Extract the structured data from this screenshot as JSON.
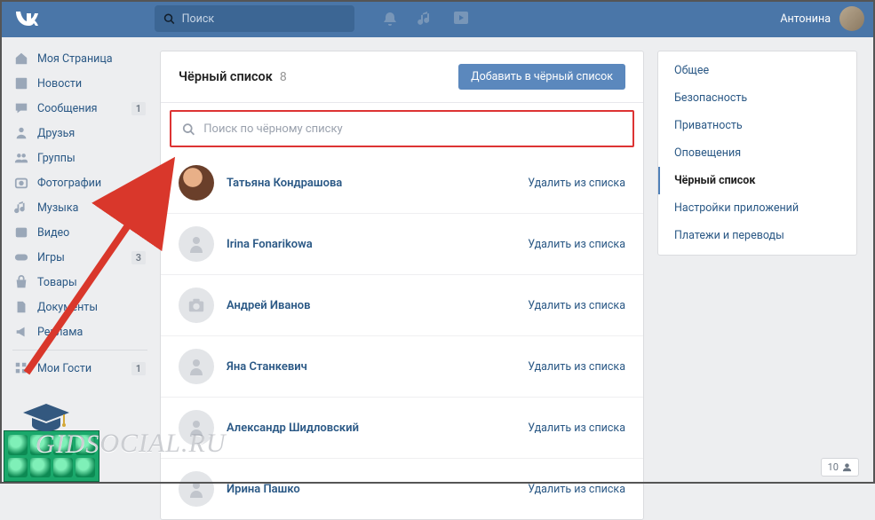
{
  "header": {
    "search_placeholder": "Поиск",
    "username": "Антонина"
  },
  "nav": {
    "items": [
      {
        "label": "Моя Страница",
        "icon": "home"
      },
      {
        "label": "Новости",
        "icon": "news"
      },
      {
        "label": "Сообщения",
        "icon": "chat",
        "badge": "1"
      },
      {
        "label": "Друзья",
        "icon": "friends"
      },
      {
        "label": "Группы",
        "icon": "groups"
      },
      {
        "label": "Фотографии",
        "icon": "photos"
      },
      {
        "label": "Музыка",
        "icon": "music"
      },
      {
        "label": "Видео",
        "icon": "video"
      },
      {
        "label": "Игры",
        "icon": "games",
        "badge": "3"
      },
      {
        "label": "Товары",
        "icon": "market"
      },
      {
        "label": "Документы",
        "icon": "docs"
      },
      {
        "label": "Реклама",
        "icon": "ads"
      }
    ],
    "guests": {
      "label": "Мои Гости",
      "badge": "1"
    }
  },
  "main": {
    "title": "Чёрный список",
    "count": "8",
    "add_button": "Добавить в чёрный список",
    "search_placeholder": "Поиск по чёрному списку",
    "remove_label": "Удалить из списка",
    "entries": [
      {
        "name": "Татьяна Кондрашова",
        "avatar": "photo"
      },
      {
        "name": "Irina Fonarikowa",
        "avatar": "deact"
      },
      {
        "name": "Андрей Иванов",
        "avatar": "cam"
      },
      {
        "name": "Яна Станкевич",
        "avatar": "deact"
      },
      {
        "name": "Александр Шидловский",
        "avatar": "deact"
      },
      {
        "name": "Ирина Пашко",
        "avatar": "deact"
      }
    ]
  },
  "settings": {
    "items": [
      {
        "label": "Общее"
      },
      {
        "label": "Безопасность"
      },
      {
        "label": "Приватность"
      },
      {
        "label": "Оповещения"
      },
      {
        "label": "Чёрный список",
        "active": true
      },
      {
        "label": "Настройки приложений"
      },
      {
        "label": "Платежи и переводы"
      }
    ]
  },
  "footer": {
    "count": "10"
  },
  "watermark": "GIDSOCIAL.RU"
}
